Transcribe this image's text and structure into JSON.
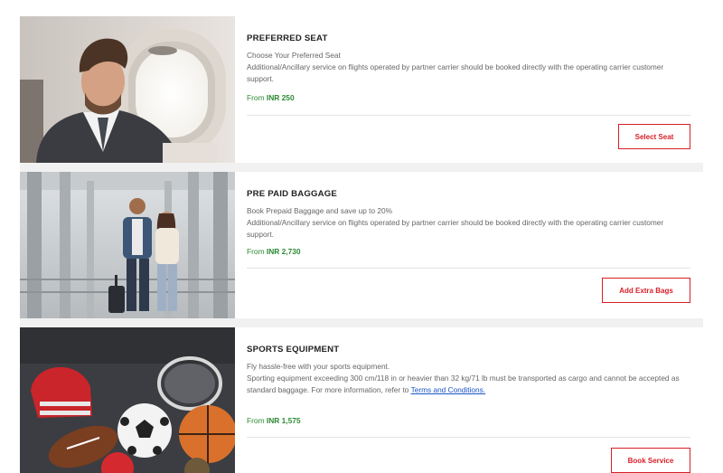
{
  "cards": [
    {
      "title": "PREFERRED SEAT",
      "desc_line1": "Choose Your Preferred Seat",
      "desc_line2": "Additional/Ancillary service on flights operated by partner carrier should be booked directly with the operating carrier customer support.",
      "price_prefix": "From",
      "price_value": "INR 250",
      "button_label": "Select Seat",
      "image": "businessman-at-airplane-window-image"
    },
    {
      "title": "PRE PAID BAGGAGE",
      "desc_line1": "Book Prepaid Baggage and save up to 20%",
      "desc_line2": "Additional/Ancillary service on flights operated by partner carrier should be booked directly with the operating carrier customer support.",
      "price_prefix": "From",
      "price_value": "INR 2,730",
      "button_label": "Add Extra Bags",
      "image": "couple-with-luggage-airport-image"
    },
    {
      "title": "SPORTS EQUIPMENT",
      "desc_line1": "Fly hassle-free with your sports equipment.",
      "desc_line2_prefix": "Sporting equipment exceeding 300 cm/118 in or heavier than 32 kg/71 lb must be transported as cargo and cannot be accepted as standard baggage. For more information, refer to",
      "desc_link": "Terms and Conditions.",
      "price_prefix": "From",
      "price_value": "INR 1,575",
      "button_label": "Book Service",
      "image": "sports-balls-and-helmet-image"
    }
  ],
  "colors": {
    "accent": "#d81f26",
    "price_green": "#2d8a34",
    "link_blue": "#1a55c8",
    "separator_bg": "#f1f1f1"
  }
}
